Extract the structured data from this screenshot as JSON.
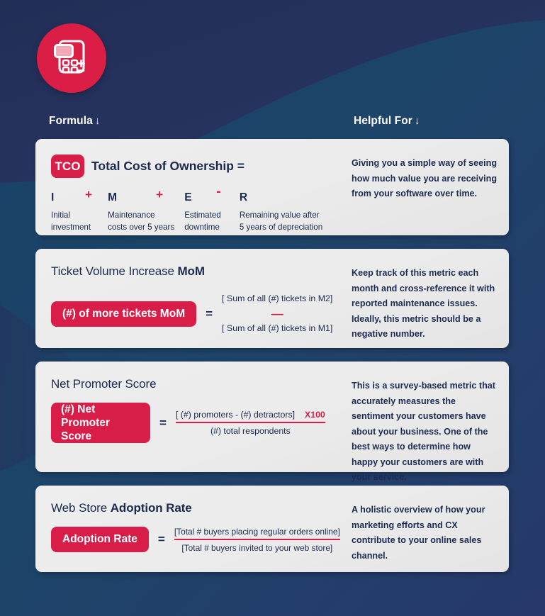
{
  "theme": {
    "bg_navy_dark": "#23305c",
    "bg_blue": "#1c4268",
    "accent_red": "#d81e48",
    "card_bg": "#ebebeb",
    "text_navy": "#1b2a4e"
  },
  "logo": {
    "icon": "calculator-icon"
  },
  "headers": {
    "formula": "Formula",
    "helpful": "Helpful For",
    "arrow": "↓"
  },
  "cards": [
    {
      "id": "tco",
      "badge": "TCO",
      "title": "Total Cost of Ownership =",
      "terms": [
        {
          "letter": "I",
          "op": "+",
          "desc": "Initial\ninvestment"
        },
        {
          "letter": "M",
          "op": "+",
          "desc": "Maintenance\ncosts over 5 years"
        },
        {
          "letter": "E",
          "op": "-",
          "desc": "Estimated\ndowntime"
        },
        {
          "letter": "R",
          "op": "",
          "desc": "Remaining value after\n5 years of depreciation"
        }
      ],
      "helpful": "Giving you a simple way of seeing how much value you are receiving from your software over time."
    },
    {
      "id": "ticket-volume",
      "title_light": "Ticket Volume Increase ",
      "title_bold": "MoM",
      "pill": "(#) of more tickets MoM",
      "equals": "=",
      "numerator": "[ Sum of all (#) tickets in M2]",
      "operator": "—",
      "denominator": "[ Sum of all (#) tickets in M1]",
      "helpful": "Keep track of this metric each month and cross-reference it with reported maintenance issues. Ideally, this metric should be a negative number."
    },
    {
      "id": "net-promoter-score",
      "title_light": "Net Promoter Score",
      "title_bold": "",
      "pill": "(#) Net\nPromoter Score",
      "equals": "=",
      "numerator": "[ (#) promoters - (#) detractors]",
      "multiplier": "X100",
      "denominator": "(#) total respondents",
      "helpful": "This is a survey-based metric that accurately measures the sentiment your customers have about your business. One of the best ways to determine how happy your customers are with your service."
    },
    {
      "id": "adoption-rate",
      "title_light": "Web Store ",
      "title_bold": "Adoption Rate",
      "pill": "Adoption Rate",
      "equals": "=",
      "numerator": "[Total # buyers placing regular orders online]",
      "denominator": "[Total # buyers invited to your web store]",
      "helpful": "A holistic overview of how your marketing efforts and CX contribute to your online sales channel."
    }
  ]
}
